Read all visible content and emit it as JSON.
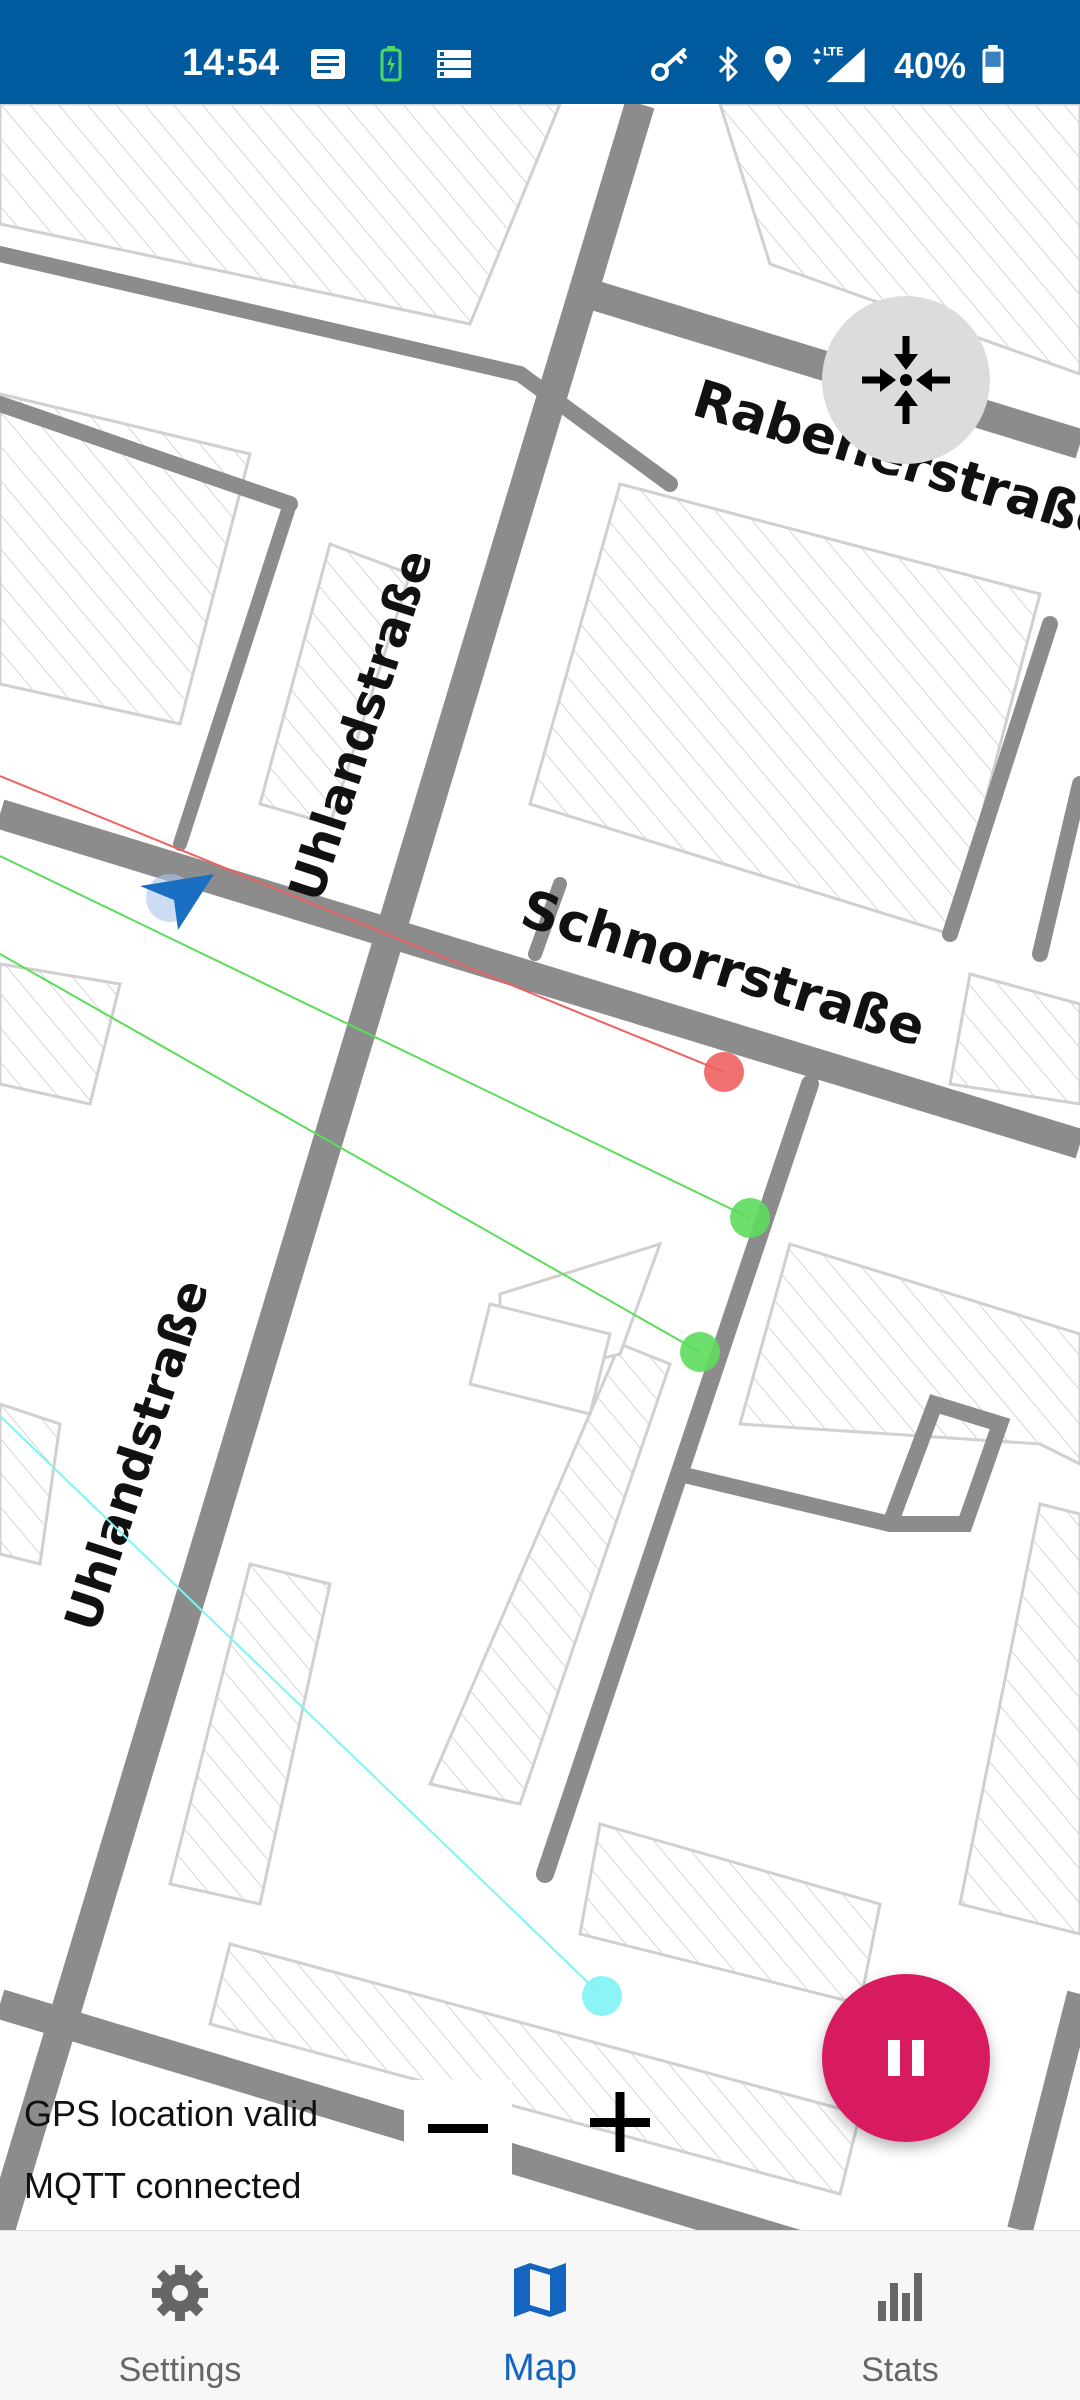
{
  "status_bar": {
    "time": "14:54",
    "battery": "40%",
    "icons": [
      "message-icon",
      "battery-saver-icon",
      "storage-icon",
      "vpn-key-icon",
      "bluetooth-icon",
      "location-icon",
      "lte-signal-icon",
      "battery-icon"
    ]
  },
  "map": {
    "street_labels": {
      "rabenerstrasse": "Rabenerstraße",
      "schnorrstrasse": "Schnorrstraße",
      "uhlandstrasse_upper": "Uhlandstraße",
      "uhlandstrasse_lower": "Uhlandstraße"
    },
    "markers": [
      {
        "name": "red-marker",
        "color": "#f06060"
      },
      {
        "name": "green-marker",
        "color": "#5cdc5c"
      },
      {
        "name": "cyan-marker",
        "color": "#7ef4f4"
      }
    ],
    "controls": {
      "recenter": "recenter-icon",
      "pause": "pause-icon",
      "zoom_out": "minus-icon",
      "zoom_in": "plus-icon"
    }
  },
  "status": {
    "gps": "GPS location valid",
    "mqtt": "MQTT connected"
  },
  "bottom_nav": {
    "items": [
      {
        "label": "Settings",
        "icon": "gear-icon",
        "active": false
      },
      {
        "label": "Map",
        "icon": "map-icon",
        "active": true
      },
      {
        "label": "Stats",
        "icon": "bar-chart-icon",
        "active": false
      }
    ]
  },
  "colors": {
    "status_bar": "#005a9e",
    "accent": "#1565c0",
    "fab": "#d81b60"
  }
}
